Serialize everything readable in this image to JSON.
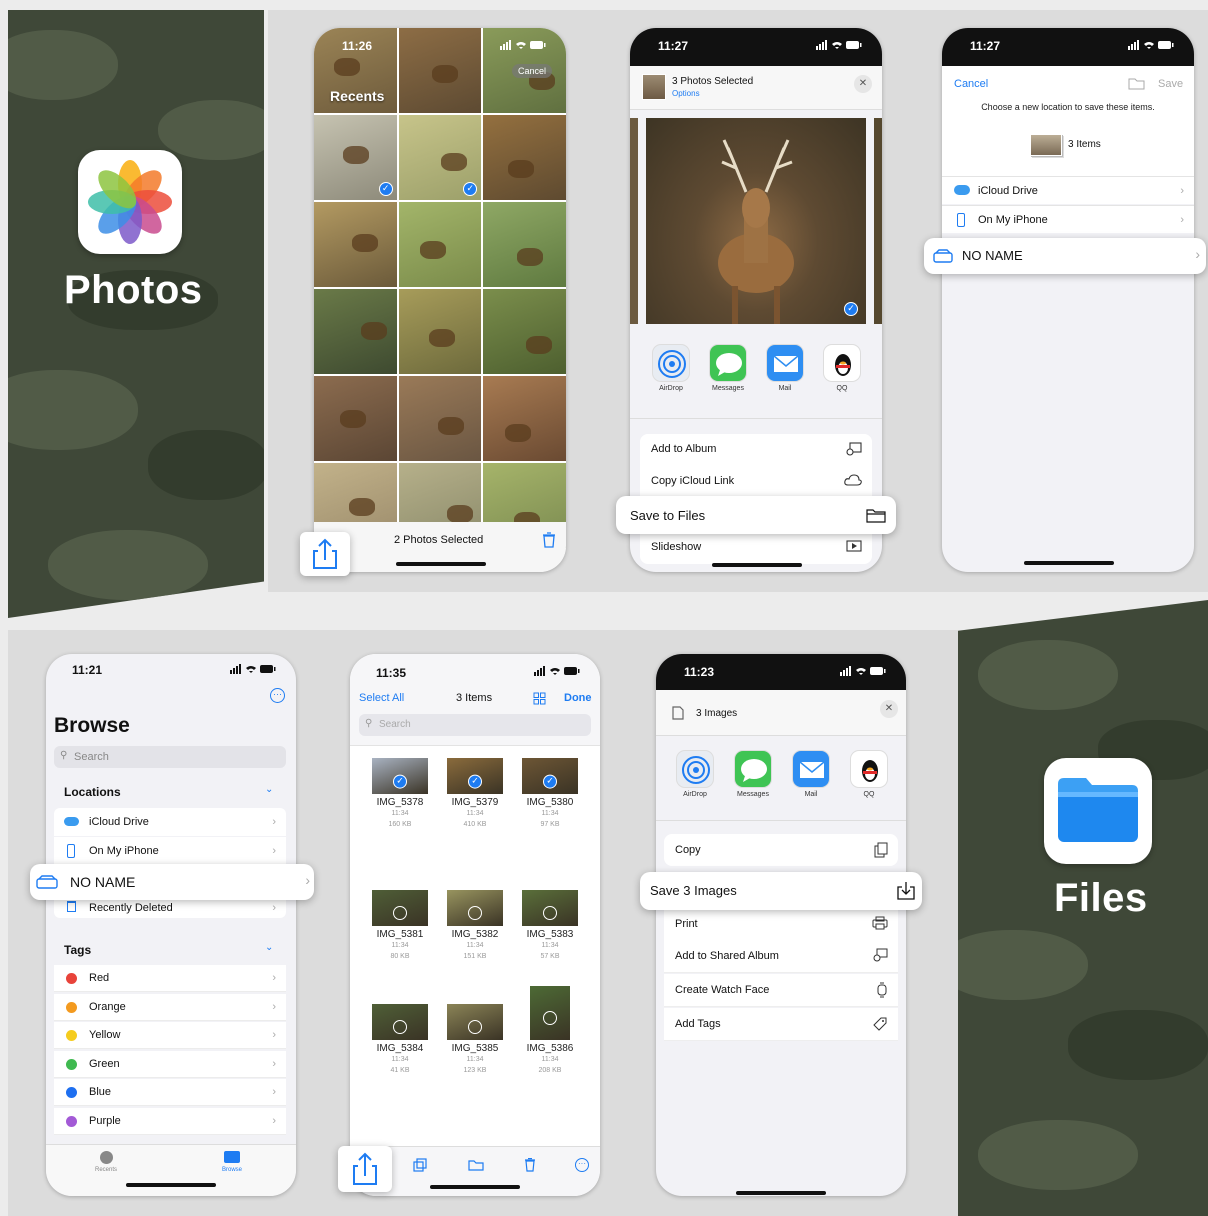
{
  "photos_brand": {
    "title": "Photos"
  },
  "files_brand": {
    "title": "Files"
  },
  "phone1": {
    "time": "11:26",
    "recents_label": "Recents",
    "cancel_label": "Cancel",
    "selected_label": "2 Photos Selected"
  },
  "phone2": {
    "time": "11:27",
    "header_title": "3 Photos Selected",
    "header_options": "Options",
    "share_apps": [
      {
        "label": "AirDrop",
        "icon": "airdrop-icon"
      },
      {
        "label": "Messages",
        "icon": "messages-icon"
      },
      {
        "label": "Mail",
        "icon": "mail-icon"
      },
      {
        "label": "QQ",
        "icon": "qq-icon"
      }
    ],
    "actions": [
      {
        "label": "Add to Album",
        "icon": "add-to-album-icon"
      },
      {
        "label": "Copy iCloud Link",
        "icon": "cloud-link-icon"
      },
      {
        "label": "Save to Files",
        "icon": "folder-icon"
      },
      {
        "label": "Slideshow",
        "icon": "play-icon"
      }
    ]
  },
  "phone3": {
    "time": "11:27",
    "cancel_label": "Cancel",
    "save_label": "Save",
    "instruction": "Choose a new location to save these items.",
    "items_label": "3 Items",
    "locations": [
      {
        "label": "iCloud Drive",
        "icon": "cloud-icon"
      },
      {
        "label": "On My iPhone",
        "icon": "phone-icon"
      },
      {
        "label": "NO NAME",
        "icon": "drive-icon"
      }
    ]
  },
  "phone4": {
    "time": "11:21",
    "title": "Browse",
    "search_placeholder": "Search",
    "locations_header": "Locations",
    "locations": [
      {
        "label": "iCloud Drive"
      },
      {
        "label": "On My iPhone"
      },
      {
        "label": "NO NAME"
      },
      {
        "label": "Recently Deleted"
      }
    ],
    "tags_header": "Tags",
    "tags": [
      {
        "label": "Red",
        "color": "#e8433a"
      },
      {
        "label": "Orange",
        "color": "#f39a1f"
      },
      {
        "label": "Yellow",
        "color": "#f5cc1e"
      },
      {
        "label": "Green",
        "color": "#3fb950"
      },
      {
        "label": "Blue",
        "color": "#1e6ff0"
      },
      {
        "label": "Purple",
        "color": "#a35ad6"
      }
    ],
    "tabs": [
      {
        "label": "Recents"
      },
      {
        "label": "Browse"
      }
    ]
  },
  "phone5": {
    "time": "11:35",
    "select_all": "Select All",
    "count": "3 Items",
    "done": "Done",
    "search_placeholder": "Search",
    "files": [
      {
        "name": "IMG_5378",
        "time": "11:34",
        "size": "160 KB",
        "selected": true
      },
      {
        "name": "IMG_5379",
        "time": "11:34",
        "size": "410 KB",
        "selected": true
      },
      {
        "name": "IMG_5380",
        "time": "11:34",
        "size": "97 KB",
        "selected": true
      },
      {
        "name": "IMG_5381",
        "time": "11:34",
        "size": "80 KB",
        "selected": false
      },
      {
        "name": "IMG_5382",
        "time": "11:34",
        "size": "151 KB",
        "selected": false
      },
      {
        "name": "IMG_5383",
        "time": "11:34",
        "size": "57 KB",
        "selected": false
      },
      {
        "name": "IMG_5384",
        "time": "11:34",
        "size": "41 KB",
        "selected": false
      },
      {
        "name": "IMG_5385",
        "time": "11:34",
        "size": "123 KB",
        "selected": false
      },
      {
        "name": "IMG_5386",
        "time": "11:34",
        "size": "208 KB",
        "selected": false
      }
    ]
  },
  "phone6": {
    "time": "11:23",
    "header_title": "3 Images",
    "share_apps": [
      {
        "label": "AirDrop"
      },
      {
        "label": "Messages"
      },
      {
        "label": "Mail"
      },
      {
        "label": "QQ"
      }
    ],
    "actions": [
      {
        "label": "Copy"
      },
      {
        "label": "Save 3 Images"
      },
      {
        "label": "Print"
      },
      {
        "label": "Add to Shared Album"
      },
      {
        "label": "Create Watch Face"
      },
      {
        "label": "Add Tags"
      }
    ]
  }
}
